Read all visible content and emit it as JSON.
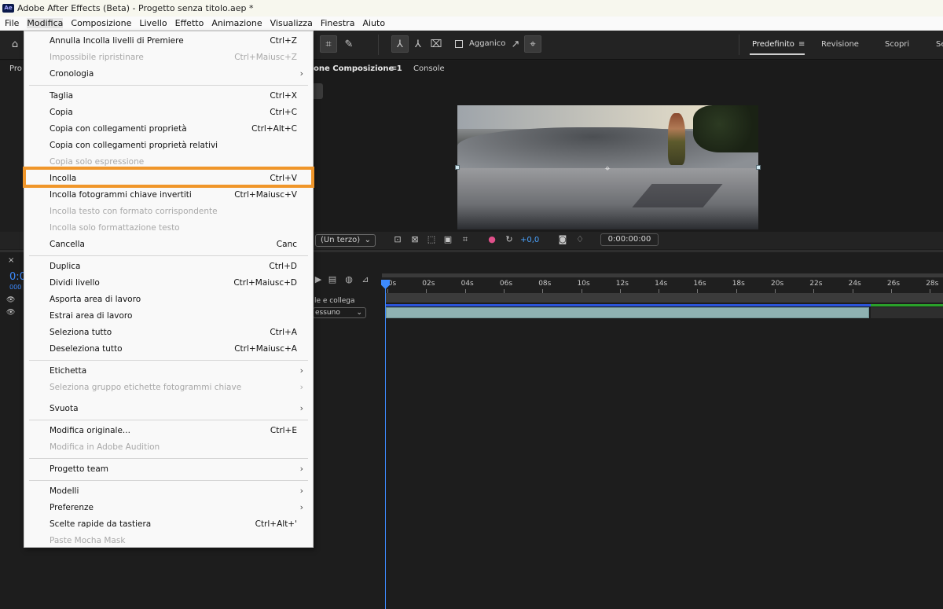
{
  "window": {
    "title": "Adobe After Effects (Beta) - Progetto senza titolo.aep *",
    "app_badge": "Ae"
  },
  "menubar": [
    "File",
    "Modifica",
    "Composizione",
    "Livello",
    "Effetto",
    "Animazione",
    "Visualizza",
    "Finestra",
    "Aiuto"
  ],
  "toolbar": {
    "snap_label": "Agganico"
  },
  "workspaces": [
    "Predefinito",
    "Revisione",
    "Scopri",
    "Se"
  ],
  "panels": {
    "left_tab": "Pro",
    "comp_tab": "one Composizione 1",
    "console_tab": "Console",
    "viewer_resolution": "(Un terzo)",
    "exposure": "+0,0",
    "timecode": "0:00:00:00",
    "timeline_time": "0:0",
    "timeline_frames": "000",
    "mode_header": "le e collega",
    "mode_dropdown": "essuno"
  },
  "ruler_ticks": [
    "00s",
    "02s",
    "04s",
    "06s",
    "08s",
    "10s",
    "12s",
    "14s",
    "16s",
    "18s",
    "20s",
    "22s",
    "24s",
    "26s",
    "28s"
  ],
  "edit_menu": [
    {
      "label": "Annulla Incolla livelli di Premiere",
      "shortcut": "Ctrl+Z",
      "disabled": false,
      "submenu": false
    },
    {
      "label": "Impossibile ripristinare",
      "shortcut": "Ctrl+Maiusc+Z",
      "disabled": true,
      "submenu": false
    },
    {
      "label": "Cronologia",
      "shortcut": "",
      "disabled": false,
      "submenu": true
    },
    {
      "separator": true
    },
    {
      "label": "Taglia",
      "shortcut": "Ctrl+X",
      "disabled": false,
      "submenu": false
    },
    {
      "label": "Copia",
      "shortcut": "Ctrl+C",
      "disabled": false,
      "submenu": false
    },
    {
      "label": "Copia con collegamenti proprietà",
      "shortcut": "Ctrl+Alt+C",
      "disabled": false,
      "submenu": false
    },
    {
      "label": "Copia con collegamenti proprietà relativi",
      "shortcut": "",
      "disabled": false,
      "submenu": false
    },
    {
      "label": "Copia solo espressione",
      "shortcut": "",
      "disabled": true,
      "submenu": false
    },
    {
      "label": "Incolla",
      "shortcut": "Ctrl+V",
      "disabled": false,
      "submenu": false,
      "highlighted": true
    },
    {
      "label": "Incolla fotogrammi chiave invertiti",
      "shortcut": "Ctrl+Maiusc+V",
      "disabled": false,
      "submenu": false
    },
    {
      "label": "Incolla testo con formato corrispondente",
      "shortcut": "",
      "disabled": true,
      "submenu": false
    },
    {
      "label": "Incolla solo formattazione testo",
      "shortcut": "",
      "disabled": true,
      "submenu": false
    },
    {
      "label": "Cancella",
      "shortcut": "Canc",
      "disabled": false,
      "submenu": false
    },
    {
      "separator": true
    },
    {
      "label": "Duplica",
      "shortcut": "Ctrl+D",
      "disabled": false,
      "submenu": false
    },
    {
      "label": "Dividi livello",
      "shortcut": "Ctrl+Maiusc+D",
      "disabled": false,
      "submenu": false
    },
    {
      "label": "Asporta area di lavoro",
      "shortcut": "",
      "disabled": false,
      "submenu": false
    },
    {
      "label": "Estrai area di lavoro",
      "shortcut": "",
      "disabled": false,
      "submenu": false
    },
    {
      "label": "Seleziona tutto",
      "shortcut": "Ctrl+A",
      "disabled": false,
      "submenu": false
    },
    {
      "label": "Deseleziona tutto",
      "shortcut": "Ctrl+Maiusc+A",
      "disabled": false,
      "submenu": false
    },
    {
      "separator": true
    },
    {
      "label": "Etichetta",
      "shortcut": "",
      "disabled": false,
      "submenu": true
    },
    {
      "label": "Seleziona gruppo etichette fotogrammi chiave",
      "shortcut": "",
      "disabled": true,
      "submenu": true
    },
    {
      "separator_gap": true
    },
    {
      "label": "Svuota",
      "shortcut": "",
      "disabled": false,
      "submenu": true
    },
    {
      "separator": true
    },
    {
      "label": "Modifica originale...",
      "shortcut": "Ctrl+E",
      "disabled": false,
      "submenu": false
    },
    {
      "label": "Modifica in Adobe Audition",
      "shortcut": "",
      "disabled": true,
      "submenu": false
    },
    {
      "separator": true
    },
    {
      "label": "Progetto team",
      "shortcut": "",
      "disabled": false,
      "submenu": true
    },
    {
      "separator": true
    },
    {
      "label": "Modelli",
      "shortcut": "",
      "disabled": false,
      "submenu": true
    },
    {
      "label": "Preferenze",
      "shortcut": "",
      "disabled": false,
      "submenu": true
    },
    {
      "label": "Scelte rapide da tastiera",
      "shortcut": "Ctrl+Alt+'",
      "disabled": false,
      "submenu": false
    },
    {
      "label": "Paste Mocha Mask",
      "shortcut": "",
      "disabled": true,
      "submenu": false
    }
  ],
  "icons": {
    "home": "home-icon",
    "anchor": "anchor-point-icon",
    "camera": "snapshot-icon",
    "chevron": "chevron-right-icon",
    "playhead": "playhead-icon"
  },
  "colors": {
    "highlight": "#f0962a",
    "playhead": "#3d8bff",
    "accent_blue": "#2a53d8",
    "accent_green": "#2aa02a"
  }
}
